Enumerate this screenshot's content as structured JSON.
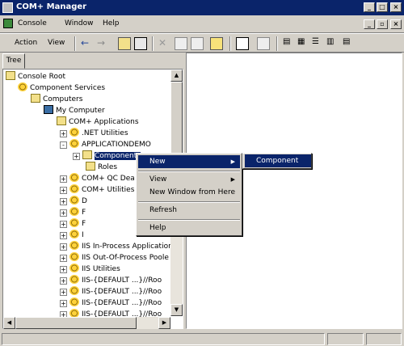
{
  "window": {
    "title": "COM+ Manager"
  },
  "menubar": {
    "console": "Console",
    "window": "Window",
    "help": "Help"
  },
  "toolbar": {
    "action": "Action",
    "view": "View"
  },
  "tabs": {
    "tree": "Tree"
  },
  "tree": {
    "items": [
      {
        "label": "Console Root",
        "icon": "folder-icon"
      },
      {
        "label": "Component Services",
        "icon": "gear-icon"
      },
      {
        "label": "Computers",
        "icon": "folder-icon"
      },
      {
        "label": "My Computer",
        "icon": "computer-icon"
      },
      {
        "label": "COM+ Applications",
        "icon": "folder-icon"
      },
      {
        "label": ".NET Utilities",
        "icon": "gear-icon"
      },
      {
        "label": "APPLICATIONDEMO",
        "icon": "gear-icon"
      },
      {
        "label": "Components",
        "icon": "folder-icon"
      },
      {
        "label": "Roles",
        "icon": "folder-icon"
      },
      {
        "label": "COM+ QC Dea",
        "icon": "gear-icon"
      },
      {
        "label": "COM+ Utilities",
        "icon": "gear-icon"
      },
      {
        "label": "D",
        "icon": "gear-icon"
      },
      {
        "label": "F",
        "icon": "gear-icon"
      },
      {
        "label": "F",
        "icon": "gear-icon"
      },
      {
        "label": "I",
        "icon": "gear-icon"
      },
      {
        "label": "IIS In-Process Application",
        "icon": "gear-icon"
      },
      {
        "label": "IIS Out-Of-Process Poole",
        "icon": "gear-icon"
      },
      {
        "label": "IIS Utilities",
        "icon": "gear-icon"
      },
      {
        "label": "IIS-{DEFAULT ...}//Roo",
        "icon": "gear-icon"
      },
      {
        "label": "IIS-{DEFAULT ...}//Roo",
        "icon": "gear-icon"
      },
      {
        "label": "IIS-{DEFAULT ...}//Roo",
        "icon": "gear-icon"
      },
      {
        "label": "IIS-{DEFAULT ...}//Roo",
        "icon": "gear-icon"
      }
    ]
  },
  "context_menu": {
    "new": "New",
    "view": "View",
    "new_window": "New Window from Here",
    "refresh": "Refresh",
    "help": "Help"
  },
  "submenu": {
    "component": "Component"
  },
  "colors": {
    "selection": "#0a246a",
    "chrome": "#d4d0c8"
  }
}
